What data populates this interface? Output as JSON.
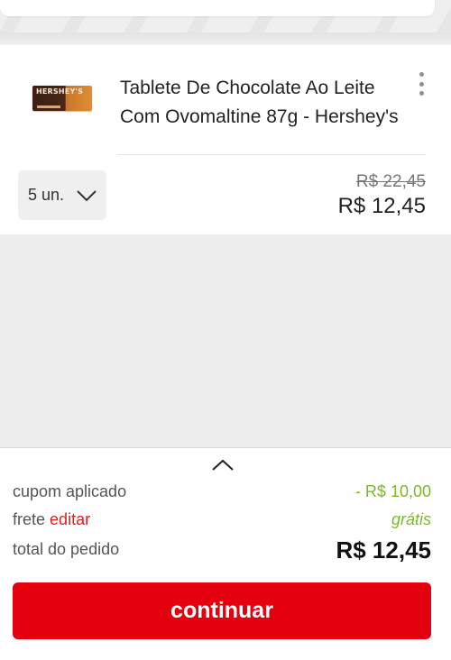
{
  "product": {
    "name": "Tablete De Chocolate Ao Leite Com Ovomaltine 87g - Hershey's",
    "brand_logo_text": "HERSHEY'S",
    "quantity": "5 un.",
    "price_original": "R$ 22,45",
    "price_current": "R$ 12,45"
  },
  "summary": {
    "coupon_label": "cupom aplicado",
    "coupon_value": "- R$ 10,00",
    "shipping_label": "frete",
    "shipping_edit": "editar",
    "shipping_value": "grátis",
    "total_label": "total do pedido",
    "total_value": "R$ 12,45"
  },
  "actions": {
    "continue_label": "continuar"
  },
  "colors": {
    "accent_red": "#e3000f",
    "discount_green": "#7cb82a"
  },
  "icons": {
    "menu": "kebab-menu-icon",
    "quantity_dropdown": "chevron-down-icon",
    "summary_toggle": "chevron-up-icon"
  }
}
